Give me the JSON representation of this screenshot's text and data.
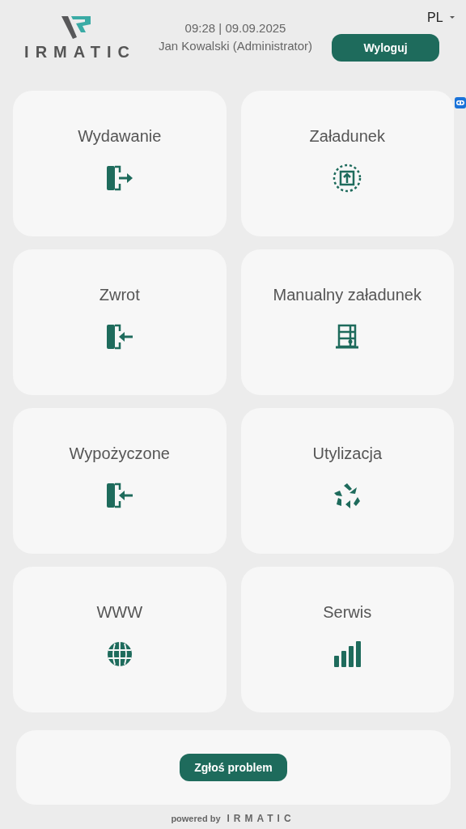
{
  "header": {
    "logo_text": "IRMATIC",
    "datetime": "09:28 | 09.09.2025",
    "user": "Jan Kowalski (Administrator)",
    "logout_button": "Wyloguj",
    "language": "PL"
  },
  "tiles": [
    {
      "label": "Wydawanie"
    },
    {
      "label": "Załadunek"
    },
    {
      "label": "Zwrot"
    },
    {
      "label": "Manualny załadunek"
    },
    {
      "label": "Wypożyczone"
    },
    {
      "label": "Utylizacja"
    },
    {
      "label": "WWW"
    },
    {
      "label": "Serwis"
    }
  ],
  "report_button": "Zgłoś problem",
  "footer": {
    "prefix": "powered by",
    "brand": "IRMATIC"
  }
}
